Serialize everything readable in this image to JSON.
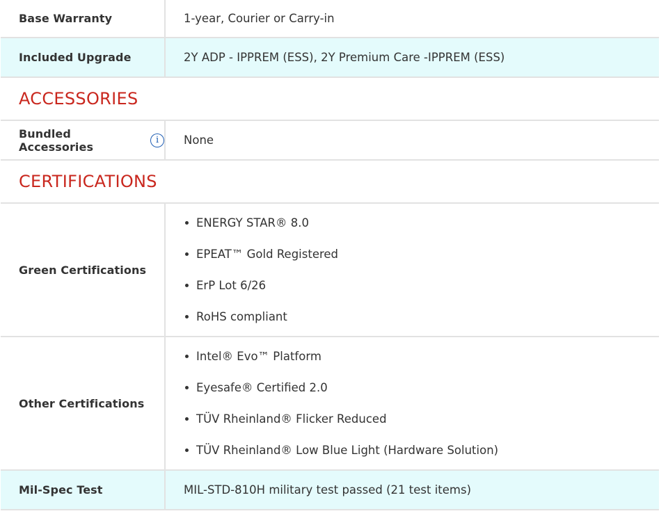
{
  "warranty": {
    "base_label": "Base Warranty",
    "base_value": "1-year, Courier or Carry-in",
    "upgrade_label": "Included Upgrade",
    "upgrade_value": "2Y ADP - IPPREM (ESS), 2Y Premium Care -IPPREM (ESS)"
  },
  "accessories": {
    "section_title": "ACCESSORIES",
    "bundled_label": "Bundled Accessories",
    "info_icon": "info-icon",
    "info_glyph": "i",
    "bundled_value": "None"
  },
  "certifications": {
    "section_title": "CERTIFICATIONS",
    "green_label": "Green Certifications",
    "green_items": [
      "ENERGY STAR® 8.0",
      "EPEAT™ Gold Registered",
      "ErP Lot 6/26",
      "RoHS compliant"
    ],
    "other_label": "Other Certifications",
    "other_items": [
      "Intel® Evo™ Platform",
      "Eyesafe® Certified 2.0",
      "TÜV Rheinland® Flicker Reduced",
      "TÜV Rheinland® Low Blue Light (Hardware Solution)"
    ],
    "milspec_label": "Mil-Spec Test",
    "milspec_value": "MIL-STD-810H military test passed (21 test items)"
  },
  "colors": {
    "section_title": "#c9271e",
    "highlight_row": "#e4fbfc",
    "border": "#e2e2e2",
    "info_icon": "#1e5db3",
    "text": "#333333"
  }
}
